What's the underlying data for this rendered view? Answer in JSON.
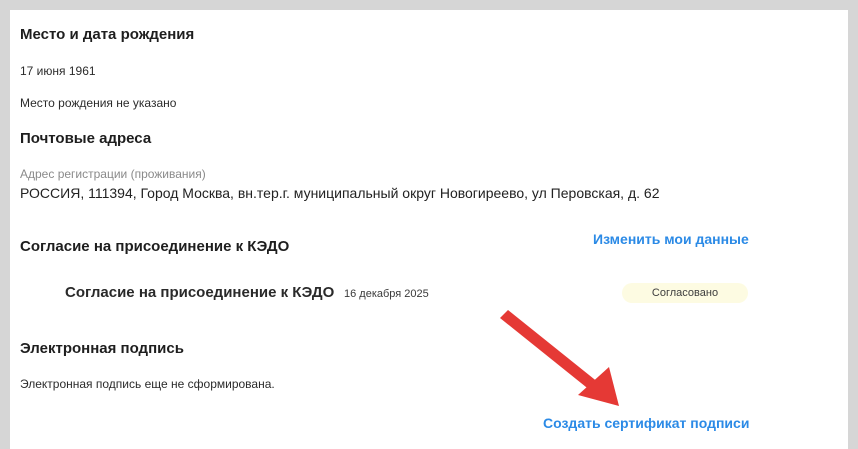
{
  "birth": {
    "heading": "Место и дата рождения",
    "date": "17 июня 1961",
    "place": "Место рождения не указано"
  },
  "postal": {
    "heading": "Почтовые адреса",
    "address_label": "Адрес регистрации (проживания)",
    "address_value": "РОССИЯ, 111394, Город Москва, вн.тер.г. муниципальный округ Новогиреево, ул Перовская, д. 62"
  },
  "consent": {
    "heading": "Согласие на присоединение к КЭДО",
    "edit_link": "Изменить мои данные",
    "document": {
      "title": "Согласие на присоединение к КЭДО",
      "date": "16 декабря 2025",
      "status": "Согласовано",
      "status_color": "#fdfbe2"
    }
  },
  "signature": {
    "heading": "Электронная подпись",
    "status_text": "Электронная подпись еще не сформирована.",
    "create_link": "Создать сертификат подписи"
  },
  "annotation": {
    "arrow_color": "#e53935",
    "icon": "red-arrow-pointing-to-create-certificate-link"
  }
}
